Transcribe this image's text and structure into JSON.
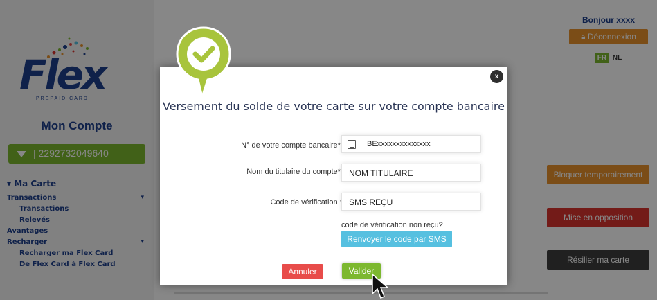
{
  "header": {
    "greeting": "Bonjour xxxx",
    "logout_label": "Déconnexion",
    "lang_fr": "FR",
    "lang_nl": "NL"
  },
  "logo": {
    "name": "Flex",
    "tagline": "PREPAID CARD"
  },
  "sidebar": {
    "title": "Mon Compte",
    "card_number": "2292732049640",
    "section": "▾ Ma Carte",
    "items": [
      {
        "label": "Transactions",
        "level": 1,
        "caret": "▾"
      },
      {
        "label": "Transactions",
        "level": 2,
        "caret": ""
      },
      {
        "label": "Relevés",
        "level": 2,
        "caret": ""
      },
      {
        "label": "Avantages",
        "level": 1,
        "caret": ""
      },
      {
        "label": "Recharger",
        "level": 1,
        "caret": "▾"
      },
      {
        "label": "Recharger ma Flex Card",
        "level": 2,
        "caret": ""
      },
      {
        "label": "De Flex Card à Flex Card",
        "level": 2,
        "caret": ""
      }
    ]
  },
  "actions": {
    "block_label": "Bloquer temporairement",
    "opposition_label": "Mise en opposition",
    "terminate_label": "Résilier ma carte"
  },
  "modal": {
    "title": "Versement du solde de votre carte sur votre compte bancaire",
    "close_label": "x",
    "account_label": "N° de votre compte bancaire*:",
    "account_value": "BExxxxxxxxxxxxxx",
    "holder_label": "Nom du titulaire du compte*:",
    "holder_value": "NOM TITULAIRE",
    "code_label": "Code de vérification *",
    "code_value": "SMS REÇU",
    "not_received_text": "code de vérification non reçu?",
    "resend_label": "Renvoyer le code par SMS",
    "cancel_label": "Annuler",
    "validate_label": "Valider"
  },
  "colors": {
    "brand_blue": "#1d3f8c",
    "green": "#7cb82f",
    "orange": "#e8912c",
    "red": "#d9332e",
    "cyan": "#56c0e0"
  }
}
